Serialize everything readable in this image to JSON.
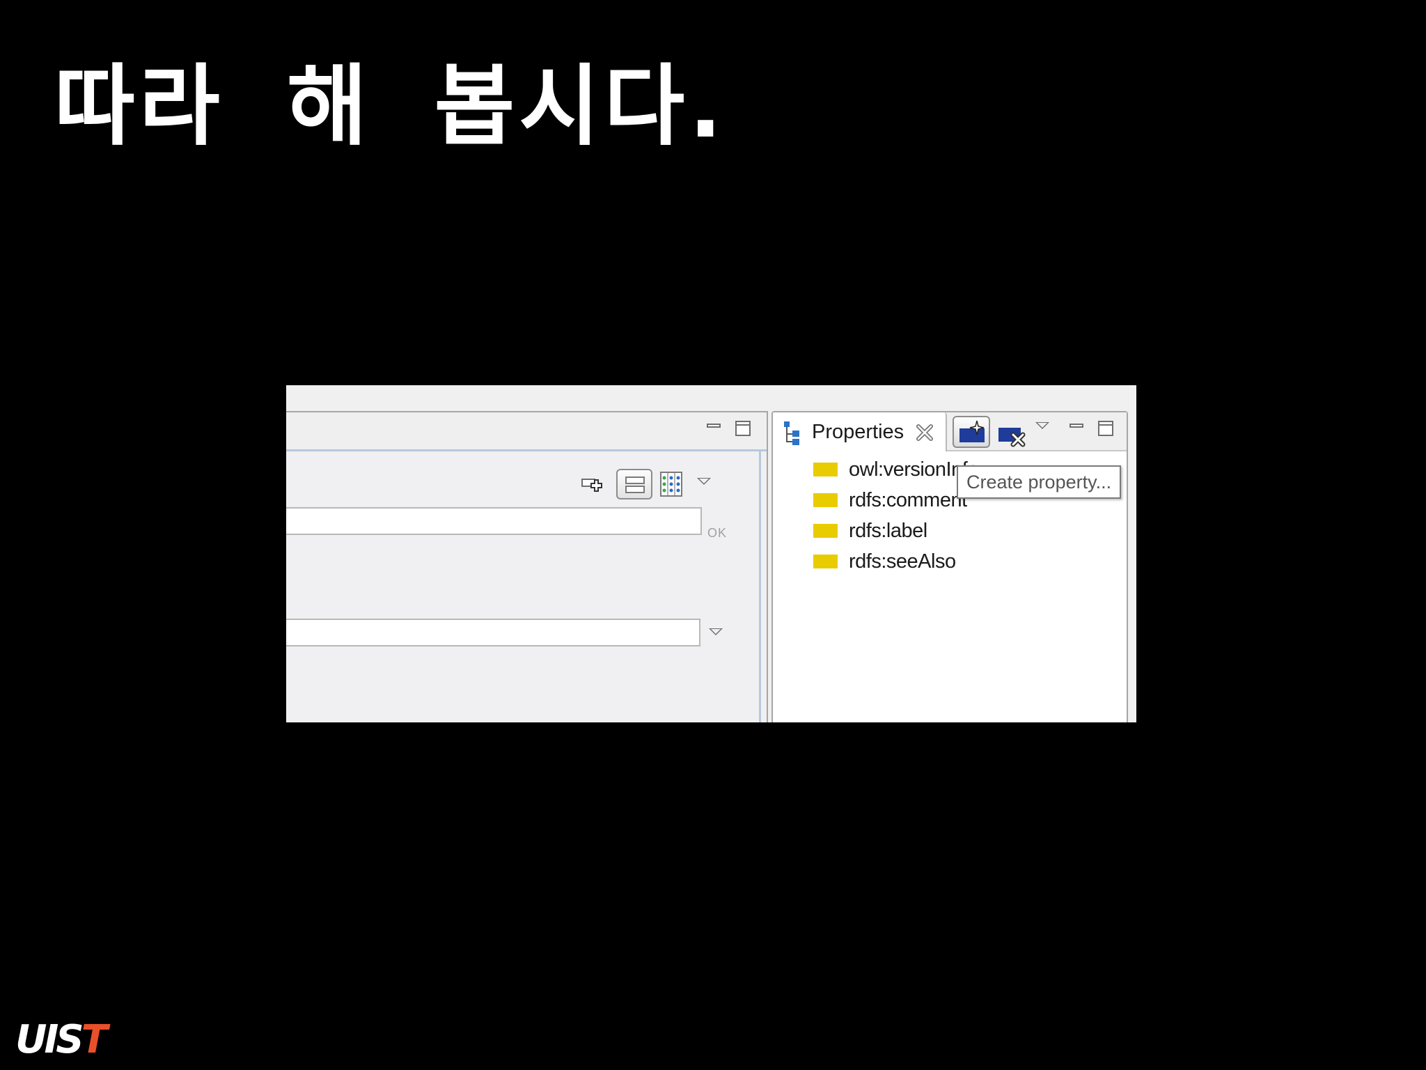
{
  "slide": {
    "title": "따라 해 봅시다."
  },
  "editor": {
    "ok_label": "OK",
    "first_field_value": "",
    "second_field_value": ""
  },
  "properties_view": {
    "tab_label": "Properties",
    "icons": {
      "tab": "tree-properties-icon",
      "close": "close-icon",
      "create": "create-property-icon",
      "delete": "delete-property-icon",
      "view_menu": "chevron-down-icon",
      "minimize": "minimize-icon",
      "maximize": "maximize-icon"
    },
    "items": [
      {
        "label": "owl:versionInfo"
      },
      {
        "label": "rdfs:comment"
      },
      {
        "label": "rdfs:label"
      },
      {
        "label": "rdfs:seeAlso"
      }
    ],
    "tooltip": "Create property..."
  },
  "colors": {
    "background": "#000000",
    "property_icon": "#e8cc00",
    "accent_blue": "#1f3c9a",
    "logo_red": "#e8502a"
  },
  "logo": {
    "part_white": "UIS",
    "part_red": "T"
  }
}
